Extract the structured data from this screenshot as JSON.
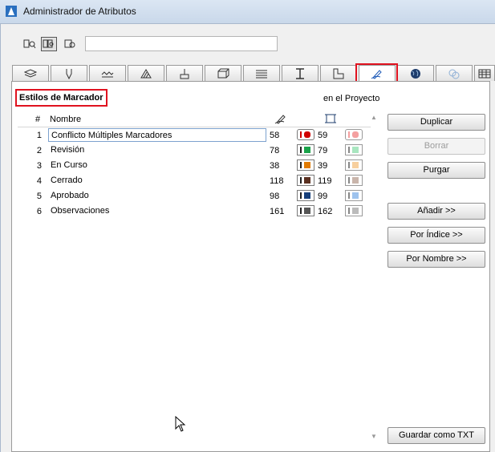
{
  "window": {
    "title": "Administrador de Atributos"
  },
  "search": {
    "value": "",
    "placeholder": ""
  },
  "section": {
    "title": "Estilos de Marcador",
    "scope": "en el Proyecto"
  },
  "tabs": [
    {
      "icon": "layers-icon"
    },
    {
      "icon": "pen-icon"
    },
    {
      "icon": "line-type-icon"
    },
    {
      "icon": "fill-icon"
    },
    {
      "icon": "brush-icon"
    },
    {
      "icon": "composite-icon"
    },
    {
      "icon": "profile-icon"
    },
    {
      "icon": "i-beam-icon"
    },
    {
      "icon": "zone-icon"
    },
    {
      "icon": "markup-pen-icon",
      "active": true
    },
    {
      "icon": "globe-icon"
    },
    {
      "icon": "material-icon"
    },
    {
      "icon": "table-icon"
    }
  ],
  "list": {
    "headers": {
      "num": "#",
      "name": "Nombre"
    },
    "rows": [
      {
        "num": "1",
        "name": "Conflicto Múltiples Marcadores",
        "v1": "58",
        "c1": "#d00000",
        "v2": "59",
        "c2": "#f4a0a0"
      },
      {
        "num": "2",
        "name": "Revisión",
        "v1": "78",
        "c1": "#1aa24a",
        "v2": "79",
        "c2": "#a9e6c0"
      },
      {
        "num": "3",
        "name": "En Curso",
        "v1": "38",
        "c1": "#e07a00",
        "v2": "39",
        "c2": "#f7cf9e"
      },
      {
        "num": "4",
        "name": "Cerrado",
        "v1": "118",
        "c1": "#5a3020",
        "v2": "119",
        "c2": "#c9b5ab"
      },
      {
        "num": "5",
        "name": "Aprobado",
        "v1": "98",
        "c1": "#163f7a",
        "v2": "99",
        "c2": "#9ec3ee"
      },
      {
        "num": "6",
        "name": "Observaciones",
        "v1": "161",
        "c1": "#555555",
        "v2": "162",
        "c2": "#bbbbbb"
      }
    ]
  },
  "buttons": {
    "duplicar": "Duplicar",
    "borrar": "Borrar",
    "purgar": "Purgar",
    "anadir": "Añadir >>",
    "por_indice": "Por Índice >>",
    "por_nombre": "Por Nombre >>",
    "guardar": "Guardar como TXT"
  }
}
